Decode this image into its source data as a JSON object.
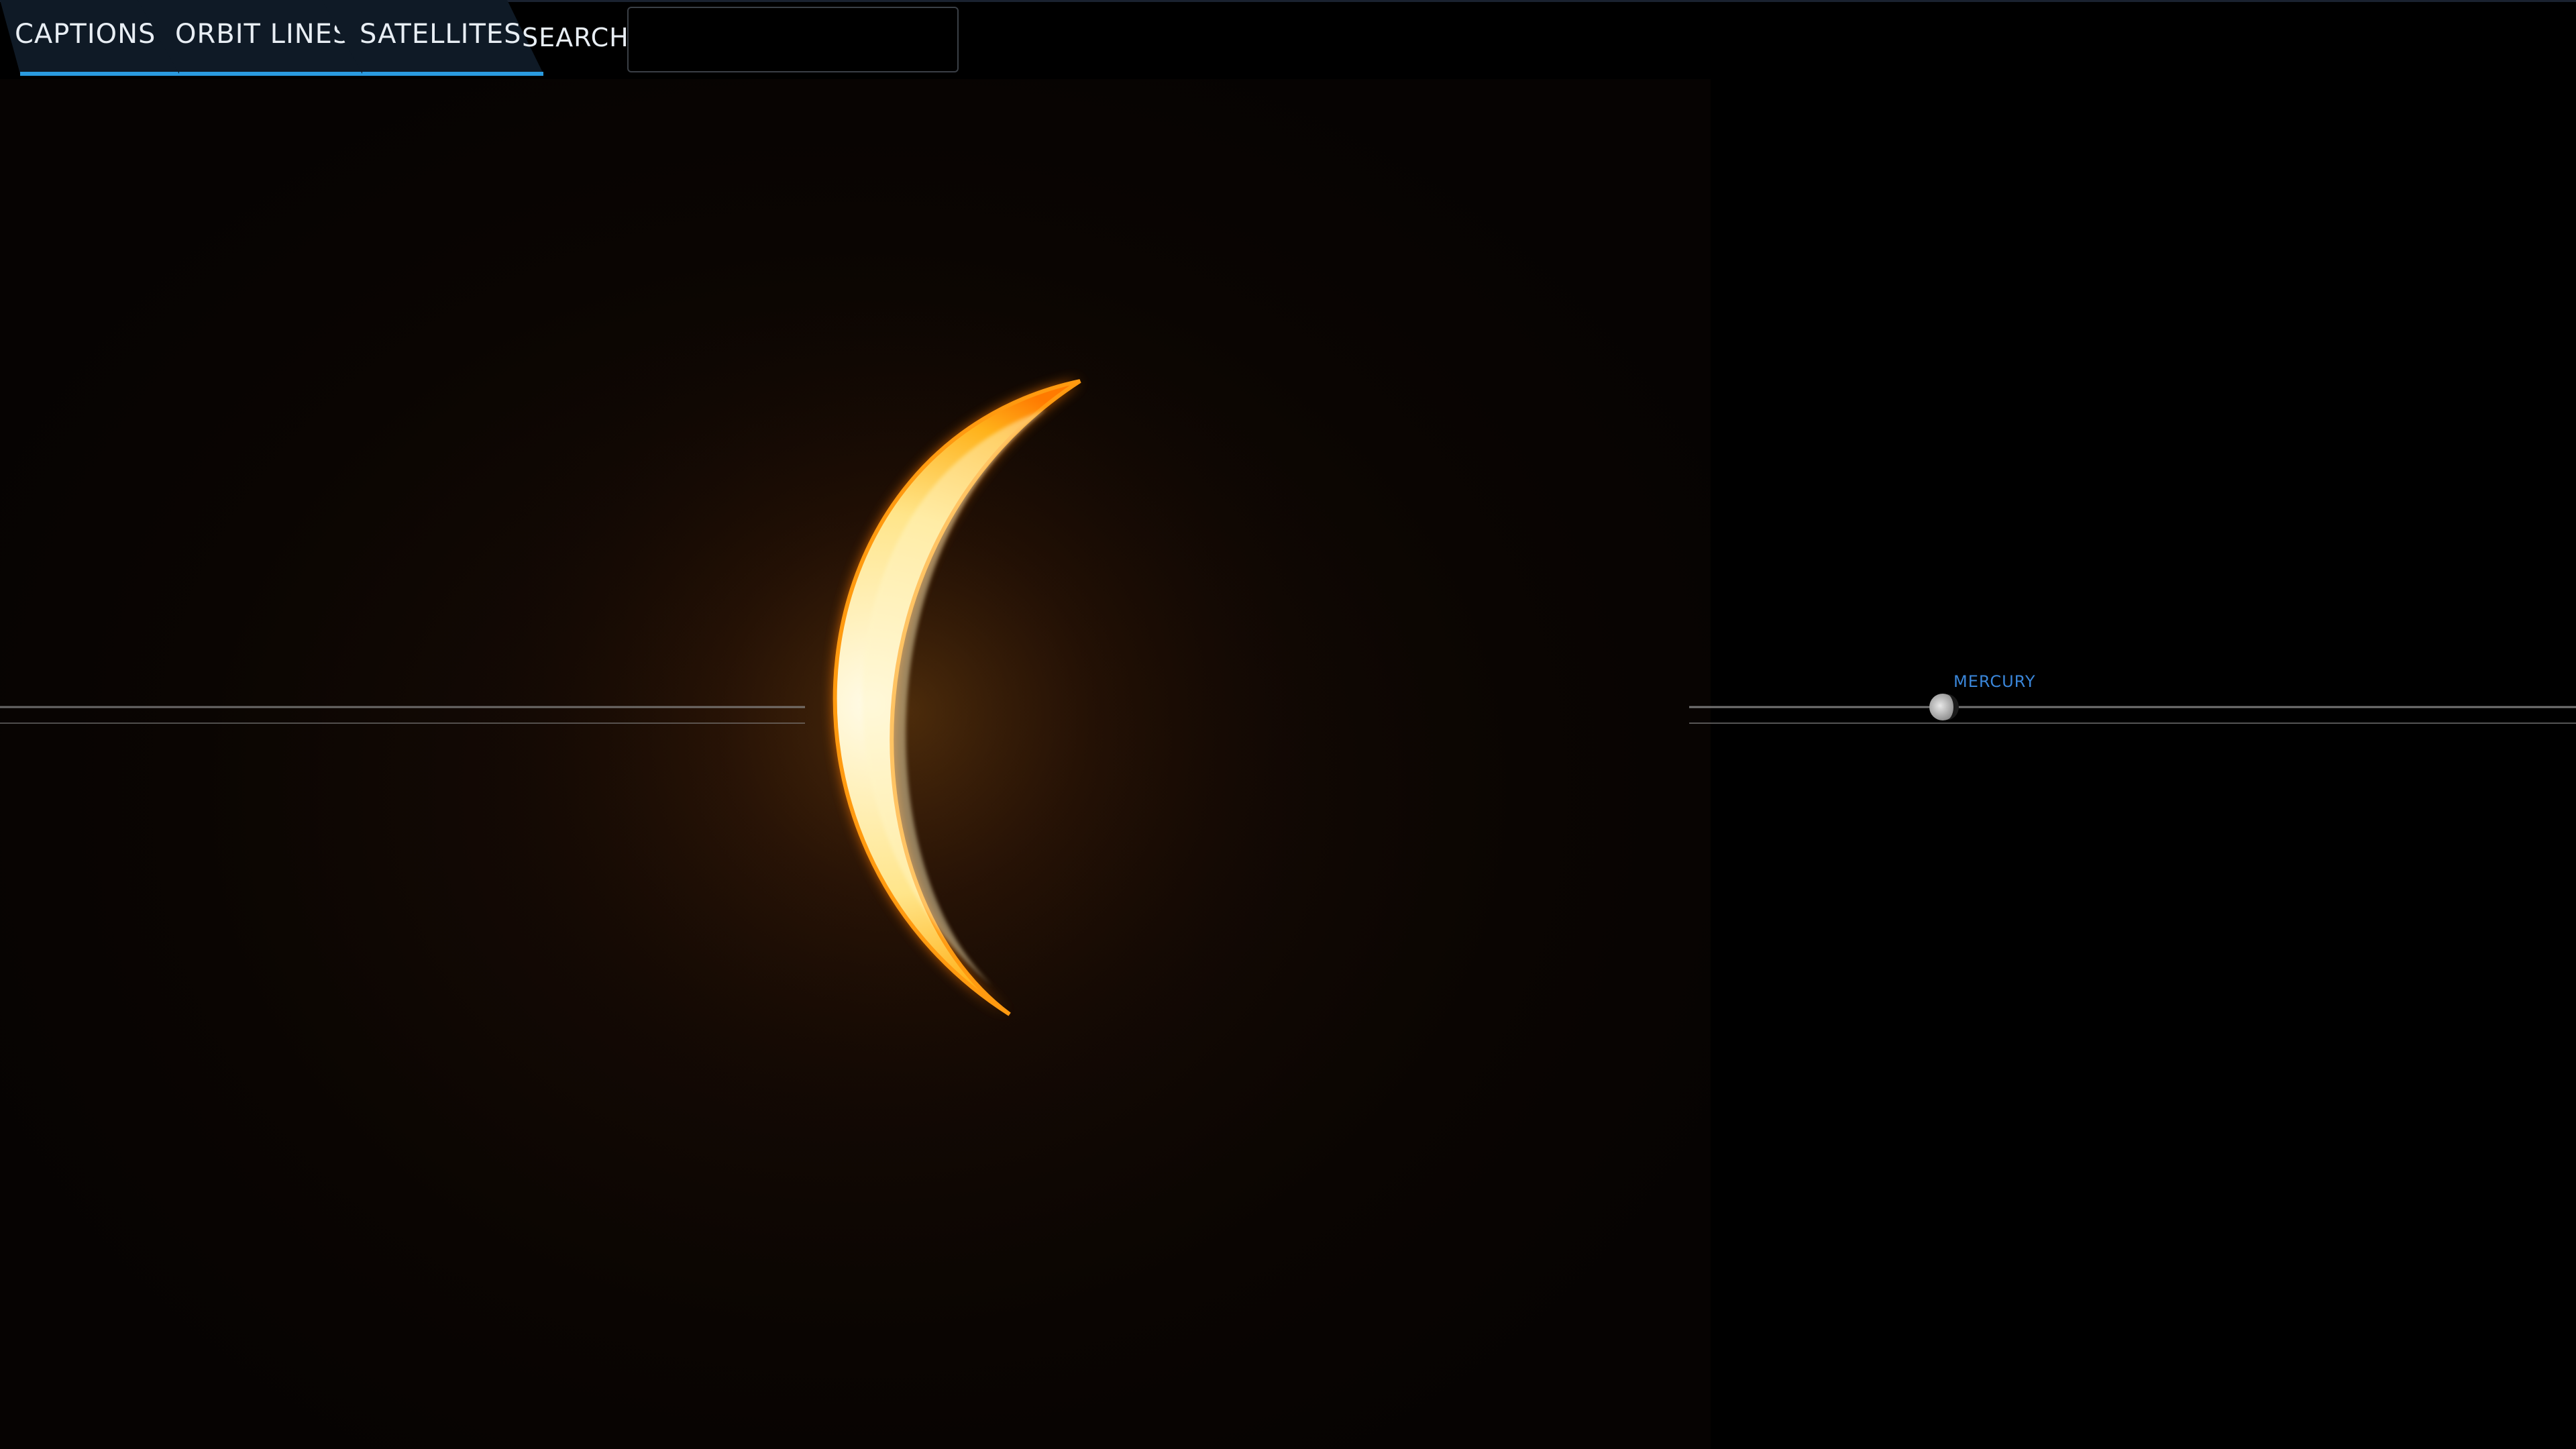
{
  "toolbar": {
    "tabs": [
      {
        "label": "CAPTIONS",
        "active": true
      },
      {
        "label": "ORBIT LINES",
        "active": true
      },
      {
        "label": "SATELLITES",
        "active": true
      }
    ],
    "search_label": "SEARCH:",
    "search_value": ""
  },
  "scene": {
    "bodies": [
      {
        "name": "Sun",
        "label": "",
        "icon": "sun-crescent"
      },
      {
        "name": "Mercury",
        "label": "MERCURY",
        "icon": "planet-mercury"
      }
    ]
  },
  "colors": {
    "background": "#000000",
    "tab_accent": "#2a9be0",
    "tab_fill": "#0f1a26",
    "caption_color": "#3a86d9",
    "orbit_line": "#8a8a8a",
    "sun_core": "#fff4c0",
    "sun_edge": "#ff8a00"
  }
}
